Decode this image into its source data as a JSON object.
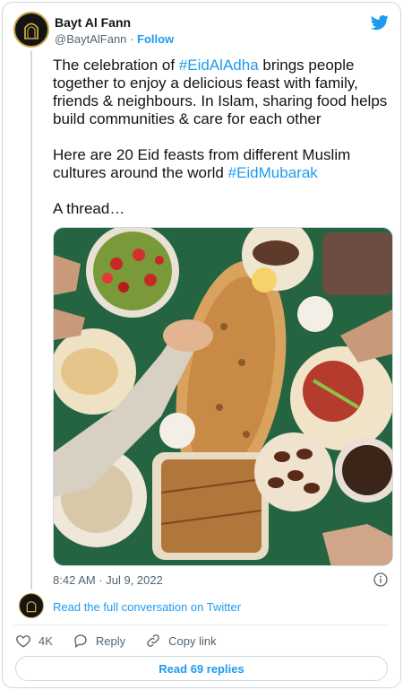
{
  "author": {
    "name": "Bayt Al Fann",
    "handle": "@BaytAlFann",
    "separator": "·",
    "follow_label": "Follow",
    "avatar_icon": "mosque-arch-logo-icon"
  },
  "tweet": {
    "line1_pre": "The celebration of ",
    "hashtag1": "#EidAlAdha",
    "line1_post": " brings people together to enjoy a delicious feast with family, friends & neighbours. In Islam, sharing food helps build communities & care for each other\n\nHere are 20 Eid feasts from different Muslim cultures around the world ",
    "hashtag2": "#EidMubarak",
    "thread_label": "\n\nA thread…",
    "image_alt": "Overhead view of an Eid feast table with salads, flatbreads, dates and hands sharing food"
  },
  "meta": {
    "timestamp": "8:42 AM · Jul 9, 2022"
  },
  "footer": {
    "read_full_label": "Read the full conversation on Twitter",
    "like_count": "4K",
    "reply_label": "Reply",
    "copy_link_label": "Copy link",
    "read_replies_label": "Read 69 replies"
  },
  "colors": {
    "accent": "#1d9bf0",
    "muted": "#536471",
    "logo_gold": "#c9a443"
  }
}
